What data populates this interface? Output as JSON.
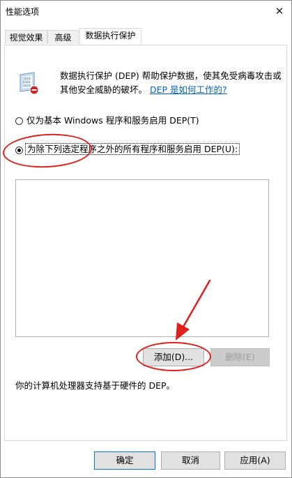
{
  "window": {
    "title": "性能选项",
    "close_glyph": "✕"
  },
  "tabs": [
    {
      "label": "视觉效果"
    },
    {
      "label": "高级"
    },
    {
      "label": "数据执行保护"
    }
  ],
  "dep": {
    "description_line1": "数据执行保护 (DEP) 帮助保护数据，使其免受病毒攻击或",
    "description_line2": "其他安全威胁的破坏。",
    "link": "DEP 是如何工作的?",
    "options": [
      {
        "label": "仅为基本 Windows 程序和服务启用 DEP(T)",
        "checked": false
      },
      {
        "label": "为除下列选定程序之外的所有程序和服务启用 DEP(U):",
        "checked": true
      }
    ],
    "add_button": "添加(D)...",
    "remove_button": "删除(E)",
    "support_text": "你的计算机处理器支持基于硬件的 DEP。"
  },
  "footer": {
    "ok": "确定",
    "cancel": "取消",
    "apply": "应用(A)"
  },
  "annotation_color": "#e0201d"
}
